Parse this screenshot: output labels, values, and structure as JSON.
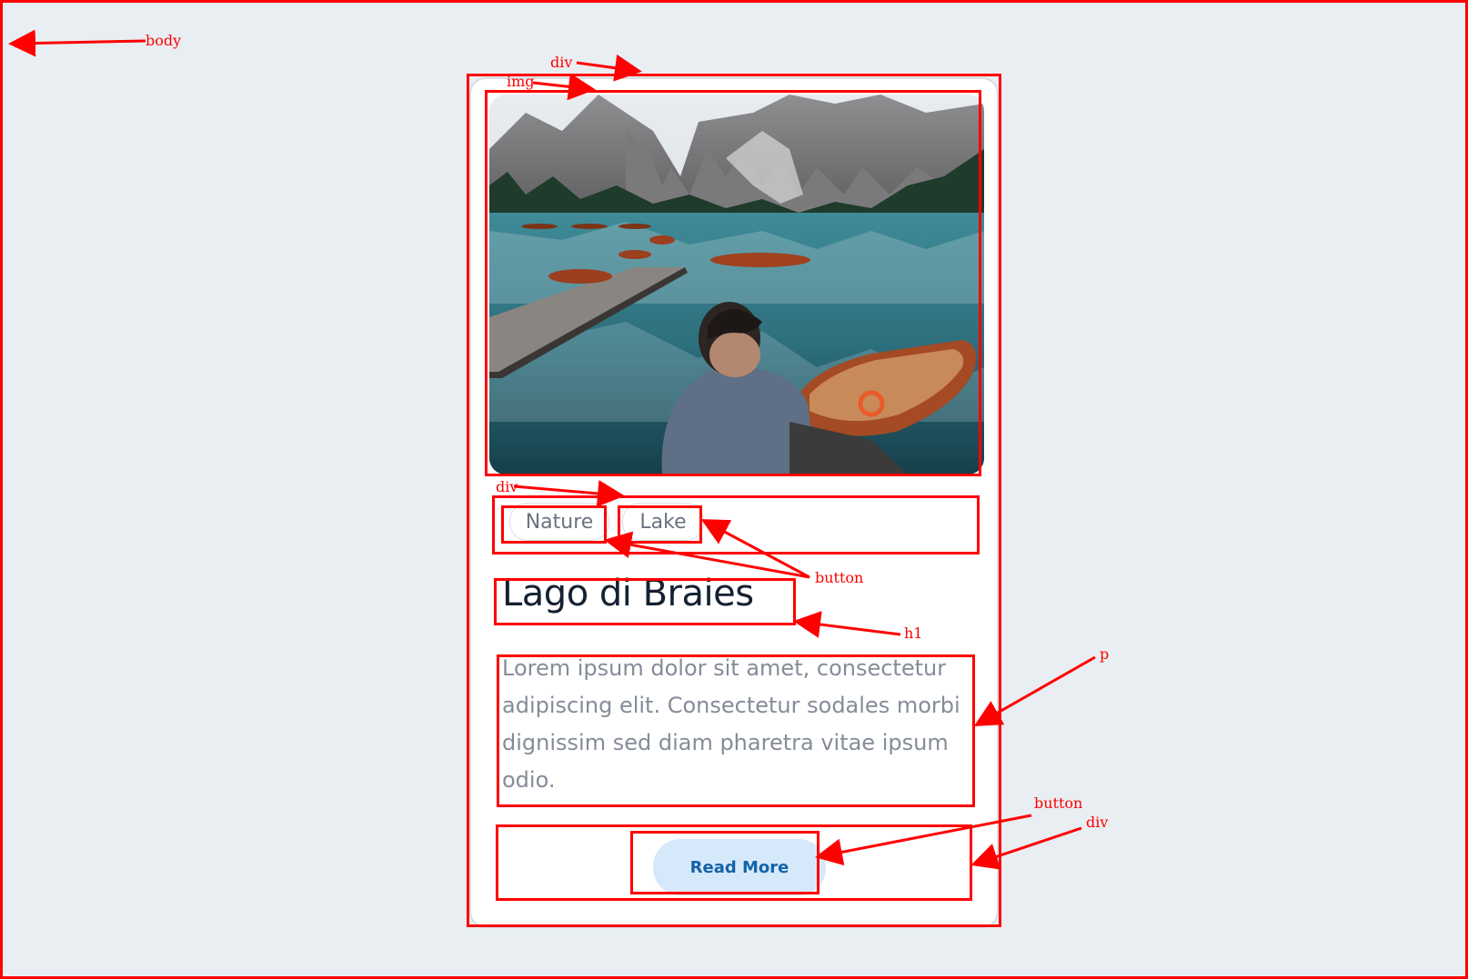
{
  "card": {
    "tags": [
      {
        "label": "Nature"
      },
      {
        "label": "Lake"
      }
    ],
    "title": "Lago di Braies",
    "description": "Lorem ipsum dolor sit amet, consectetur adipiscing elit. Consectetur sodales morbi dignissim sed diam pharetra vitae ipsum odio.",
    "cta": {
      "label": "Read More"
    }
  },
  "annotations": {
    "body": "body",
    "card_div": "div",
    "img": "img",
    "tags_div": "div",
    "tag_buttons": "button",
    "title_h1": "h1",
    "desc_p": "p",
    "cta_button": "button",
    "cta_div": "div"
  },
  "colors": {
    "page_background": "#e9eef2",
    "card_background": "#ffffff",
    "annotation": "#ff0000",
    "title_text": "#142132",
    "body_text": "#858c98",
    "tag_text": "#6b7380",
    "cta_background": "#d6e9fb",
    "cta_text": "#1463a8"
  }
}
